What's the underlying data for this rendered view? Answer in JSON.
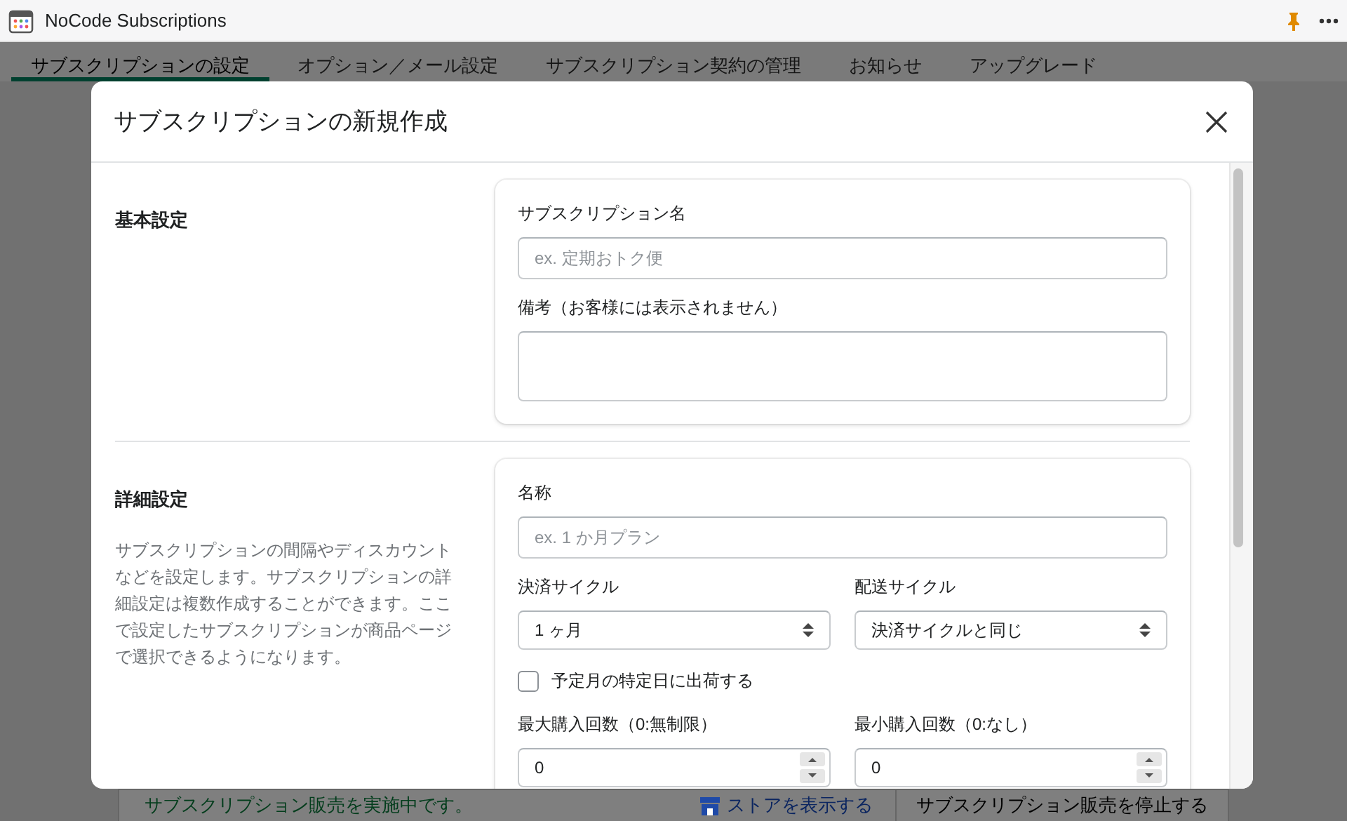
{
  "app_bar": {
    "title": "NoCode Subscriptions"
  },
  "tabs": [
    {
      "label": "サブスクリプションの設定",
      "selected": true
    },
    {
      "label": "オプション／メール設定",
      "selected": false
    },
    {
      "label": "サブスクリプション契約の管理",
      "selected": false
    },
    {
      "label": "お知らせ",
      "selected": false
    },
    {
      "label": "アップグレード",
      "selected": false
    }
  ],
  "banner": {
    "message": "サブスクリプション販売を実施中です。",
    "link": "ストアを表示する",
    "button": "サブスクリプション販売を停止する"
  },
  "modal": {
    "title": "サブスクリプションの新規作成",
    "sections": [
      {
        "title": "基本設定",
        "rows": [
          [
            {
              "kind": "text",
              "label": "サブスクリプション名",
              "placeholder": "ex. 定期おトク便"
            }
          ],
          [
            {
              "kind": "textarea",
              "label": "備考（お客様には表示されません）"
            }
          ]
        ]
      },
      {
        "title": "詳細設定",
        "description": "サブスクリプションの間隔やディスカウントなどを設定します。サブスクリプションの詳細設定は複数作成することができます。ここで設定したサブスクリプションが商品ページで選択できるようになります。",
        "rows": [
          [
            {
              "kind": "text",
              "label": "名称",
              "placeholder": "ex. 1 か月プラン"
            }
          ],
          [
            {
              "kind": "select",
              "label": "決済サイクル",
              "value": "1 ヶ月"
            },
            {
              "kind": "select",
              "label": "配送サイクル",
              "value": "決済サイクルと同じ"
            }
          ],
          [
            {
              "kind": "checkbox",
              "label": "予定月の特定日に出荷する",
              "checked": false
            }
          ],
          [
            {
              "kind": "number",
              "label": "最大購入回数（0:無制限）",
              "value": "0"
            },
            {
              "kind": "number",
              "label": "最小購入回数（0:なし）",
              "value": "0"
            }
          ]
        ]
      }
    ]
  }
}
